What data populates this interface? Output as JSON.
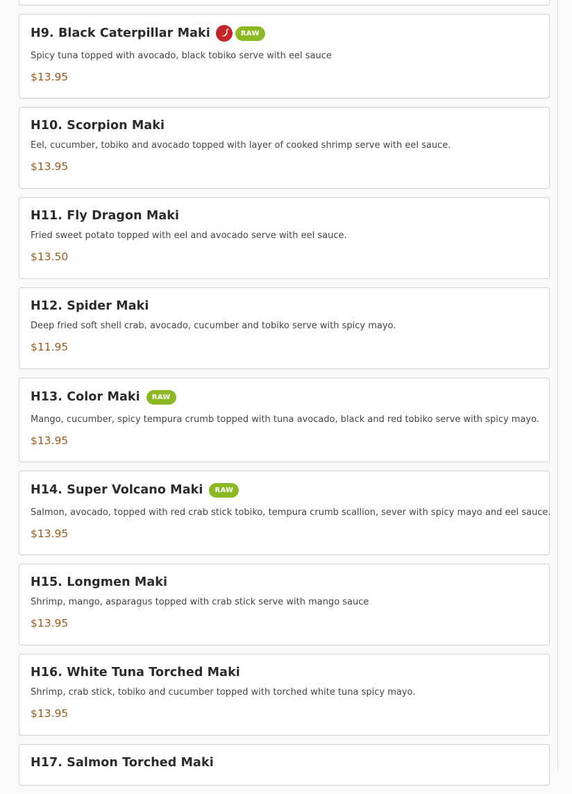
{
  "menu": {
    "items": [
      {
        "name": "H9. Black Caterpillar Maki",
        "spicy_icon": "chili-pepper-icon",
        "badge": "RAW",
        "description": "Spicy tuna topped with avocado, black tobiko serve with eel sauce",
        "price": "$13.95"
      },
      {
        "name": "H10. Scorpion Maki",
        "description": "Eel, cucumber, tobiko and avocado topped with layer of cooked shrimp serve with eel sauce.",
        "price": "$13.95"
      },
      {
        "name": "H11. Fly Dragon Maki",
        "description": "Fried sweet potato topped with eel and avocado serve with eel sauce.",
        "price": "$13.50"
      },
      {
        "name": "H12. Spider Maki",
        "description": "Deep fried soft shell crab, avocado, cucumber and tobiko serve with spicy mayo.",
        "price": "$11.95"
      },
      {
        "name": "H13. Color Maki",
        "badge": "RAW",
        "description": "Mango, cucumber, spicy tempura crumb topped with tuna avocado, black and red tobiko serve with spicy mayo.",
        "price": "$13.95"
      },
      {
        "name": "H14. Super Volcano Maki",
        "badge": "RAW",
        "description": "Salmon, avocado, topped with red crab stick tobiko, tempura crumb scallion, sever with spicy mayo and eel sauce.",
        "price": "$13.95"
      },
      {
        "name": "H15. Longmen Maki",
        "description": "Shrimp, mango, asparagus topped with crab stick serve with mango sauce",
        "price": "$13.95"
      },
      {
        "name": "H16. White Tuna Torched Maki",
        "description": "Shrimp, crab stick, tobiko and cucumber topped with torched white tuna spicy mayo.",
        "price": "$13.95"
      },
      {
        "name": "H17. Salmon Torched Maki"
      }
    ]
  },
  "colors": {
    "price": "#9a5b1d",
    "raw_badge": "#8cb823",
    "spicy_icon": "#c3262a"
  }
}
